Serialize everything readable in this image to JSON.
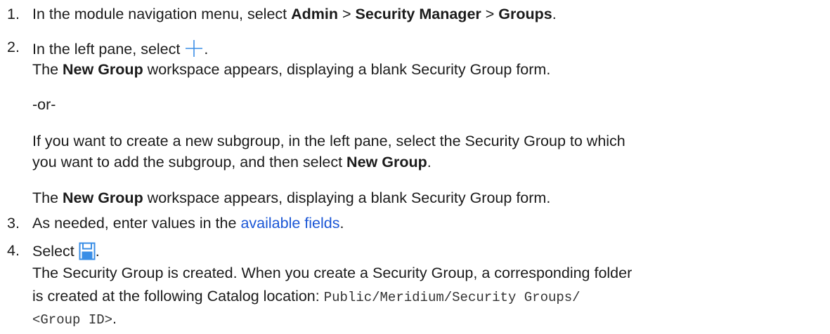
{
  "steps": [
    {
      "number": "1.",
      "pre": "In the module navigation menu, select ",
      "crumb1": "Admin",
      "sep1": " > ",
      "crumb2": "Security Manager",
      "sep2": " > ",
      "crumb3": "Groups",
      "post": "."
    },
    {
      "number": "2.",
      "pre": "In the left pane, select ",
      "post": ".",
      "icon": "plus-icon",
      "result_bold": "New Group",
      "result_rest": " workspace appears, displaying a blank Security Group form.",
      "result_prefix": "The ",
      "or_text": "-or-",
      "alt_line1": "If you want to create a new subgroup, in the left pane, select the Security Group to which",
      "alt_line2_pre": "you want to add the subgroup, and then select ",
      "alt_line2_bold": "New Group",
      "alt_line2_post": ".",
      "result2_prefix": "The ",
      "result2_bold": "New Group",
      "result2_rest": " workspace appears, displaying a blank Security Group form."
    },
    {
      "number": "3.",
      "pre": "As needed, enter values in the ",
      "link": "available fields",
      "post": "."
    },
    {
      "number": "4.",
      "pre": "Select ",
      "post": ".",
      "icon": "save-icon",
      "line1": "The Security Group is created. When you create a Security Group, a corresponding folder",
      "line2_pre": "is created at the following Catalog location: ",
      "line2_code": "Public/Meridium/Security Groups/",
      "line3_code": "<Group ID>",
      "line3_post": "."
    }
  ],
  "colors": {
    "text": "#1b1b1b",
    "link": "#1a56d6",
    "icon": "#3a8ee6"
  }
}
